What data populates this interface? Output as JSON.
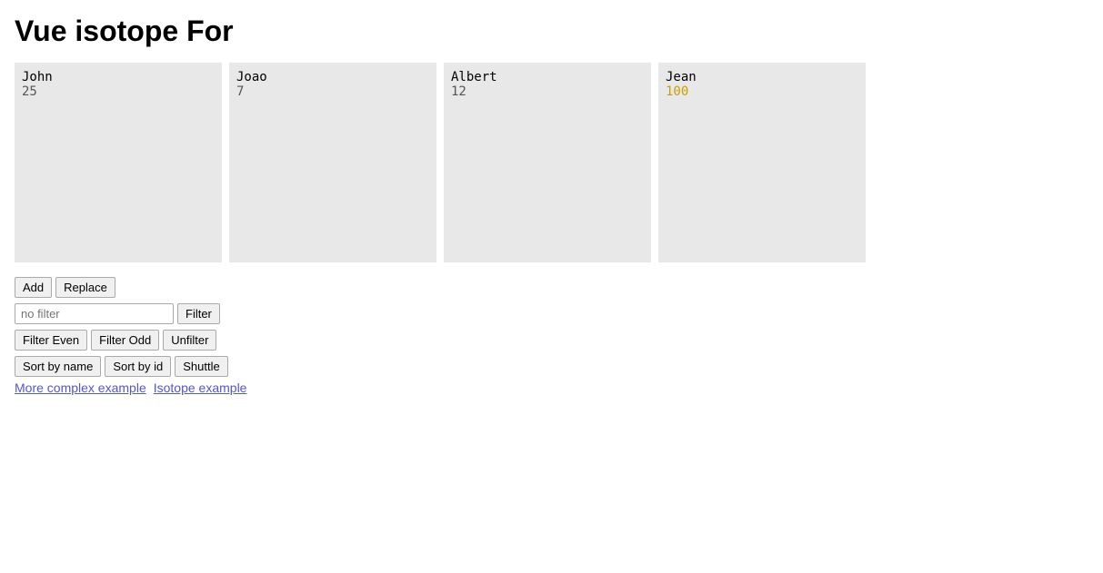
{
  "page": {
    "title": "Vue isotope For"
  },
  "cards": [
    {
      "name": "John",
      "id": "25",
      "highlight": false
    },
    {
      "name": "Joao",
      "id": "7",
      "highlight": false
    },
    {
      "name": "Albert",
      "id": "12",
      "highlight": false
    },
    {
      "name": "Jean",
      "id": "100",
      "highlight": true
    }
  ],
  "controls": {
    "add_label": "Add",
    "replace_label": "Replace",
    "filter_input_placeholder": "no filter",
    "filter_button_label": "Filter",
    "filter_even_label": "Filter Even",
    "filter_odd_label": "Filter Odd",
    "unfilter_label": "Unfilter",
    "sort_by_name_label": "Sort by name",
    "sort_by_id_label": "Sort by id",
    "shuttle_label": "Shuttle"
  },
  "links": [
    {
      "label": "More complex example",
      "href": "#"
    },
    {
      "label": "Isotope example",
      "href": "#"
    }
  ]
}
